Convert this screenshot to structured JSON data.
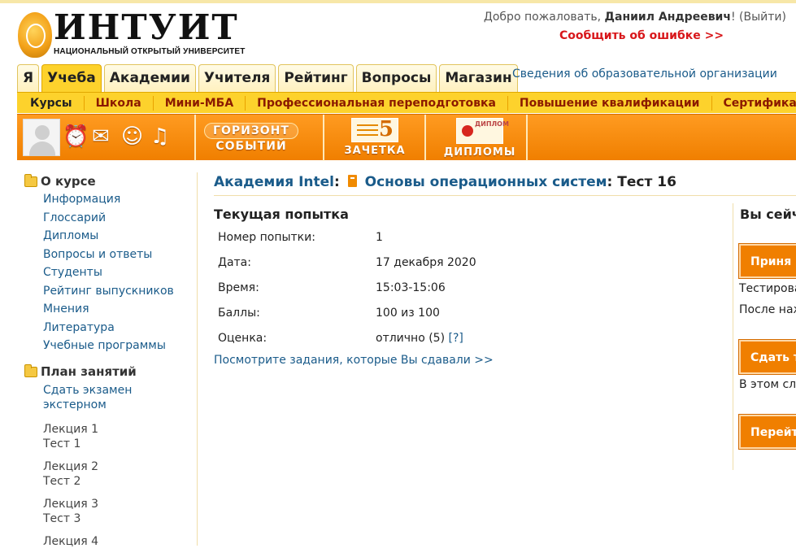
{
  "header": {
    "logo_text": "ИНТУИТ",
    "logo_subtitle": "НАЦИОНАЛЬНЫЙ ОТКРЫТЫЙ УНИВЕРСИТЕТ",
    "welcome_prefix": "Добро пожаловать, ",
    "user_name": "Даниил Андреевич",
    "welcome_suffix": "! (",
    "logout_label": "Выйти",
    "close_paren": ")",
    "report_error": "Сообщить об ошибке >>"
  },
  "main_tabs": [
    {
      "label": "Я",
      "active": false
    },
    {
      "label": "Учеба",
      "active": true
    },
    {
      "label": "Академии",
      "active": false
    },
    {
      "label": "Учителя",
      "active": false
    },
    {
      "label": "Рейтинг",
      "active": false
    },
    {
      "label": "Вопросы",
      "active": false
    },
    {
      "label": "Магазин",
      "active": false
    }
  ],
  "org_info_link": "Сведения об образовательной организации",
  "sub_nav": [
    "Курсы",
    "Школа",
    "Мини-МБА",
    "Профессиональная переподготовка",
    "Повышение квалификации",
    "Сертификация"
  ],
  "toolbar": {
    "horizon_line1": "ГОРИЗОНТ",
    "horizon_line2": "СОБЫТИЙ",
    "gradebook_number": "5",
    "gradebook_label": "ЗАЧЕТКА",
    "diploma_card": "ДИПЛОМ",
    "diplomas_label": "ДИПЛОМЫ",
    "icons": [
      "avatar",
      "alarm-clock-icon",
      "envelope-icon",
      "people-icon",
      "bell-icon"
    ]
  },
  "sidebar": {
    "about_title": "О курсе",
    "about_links": [
      "Информация",
      "Глоссарий",
      "Дипломы",
      "Вопросы и ответы",
      "Студенты",
      "Рейтинг выпускников",
      "Мнения",
      "Литература",
      "Учебные программы"
    ],
    "plan_title": "План занятий",
    "exam_link_line1": "Сдать экзамен",
    "exam_link_line2": "экстерном",
    "lessons": [
      {
        "lecture": "Лекция 1",
        "test": "Тест 1"
      },
      {
        "lecture": "Лекция 2",
        "test": "Тест 2"
      },
      {
        "lecture": "Лекция 3",
        "test": "Тест 3"
      },
      {
        "lecture": "Лекция 4",
        "test": ""
      }
    ]
  },
  "breadcrumb": {
    "academy": "Академия Intel",
    "course": "Основы операционных систем",
    "current": "Тест 16"
  },
  "attempt": {
    "title": "Текущая попытка",
    "rows": [
      {
        "label": "Номер попытки:",
        "value": "1"
      },
      {
        "label": "Дата:",
        "value": "17 декабря 2020"
      },
      {
        "label": "Время:",
        "value": "15:03-15:06"
      },
      {
        "label": "Баллы:",
        "value": "100 из 100"
      },
      {
        "label": "Оценка:",
        "value": "отлично (5)"
      }
    ],
    "help_link": "[?]",
    "view_tasks_link": "Посмотрите задания, которые Вы сдавали >>"
  },
  "right_panel": {
    "title": "Вы сейч",
    "button1": "Приня",
    "text1": "Тестирова",
    "text2": "После наж",
    "button2": "Сдать т",
    "text3": "В этом слу",
    "button3": "Перейт"
  },
  "colors": {
    "accent_orange": "#f07f00",
    "tab_yellow": "#fdd22c",
    "link_blue": "#1a5b8a",
    "error_red": "#d8161a"
  }
}
